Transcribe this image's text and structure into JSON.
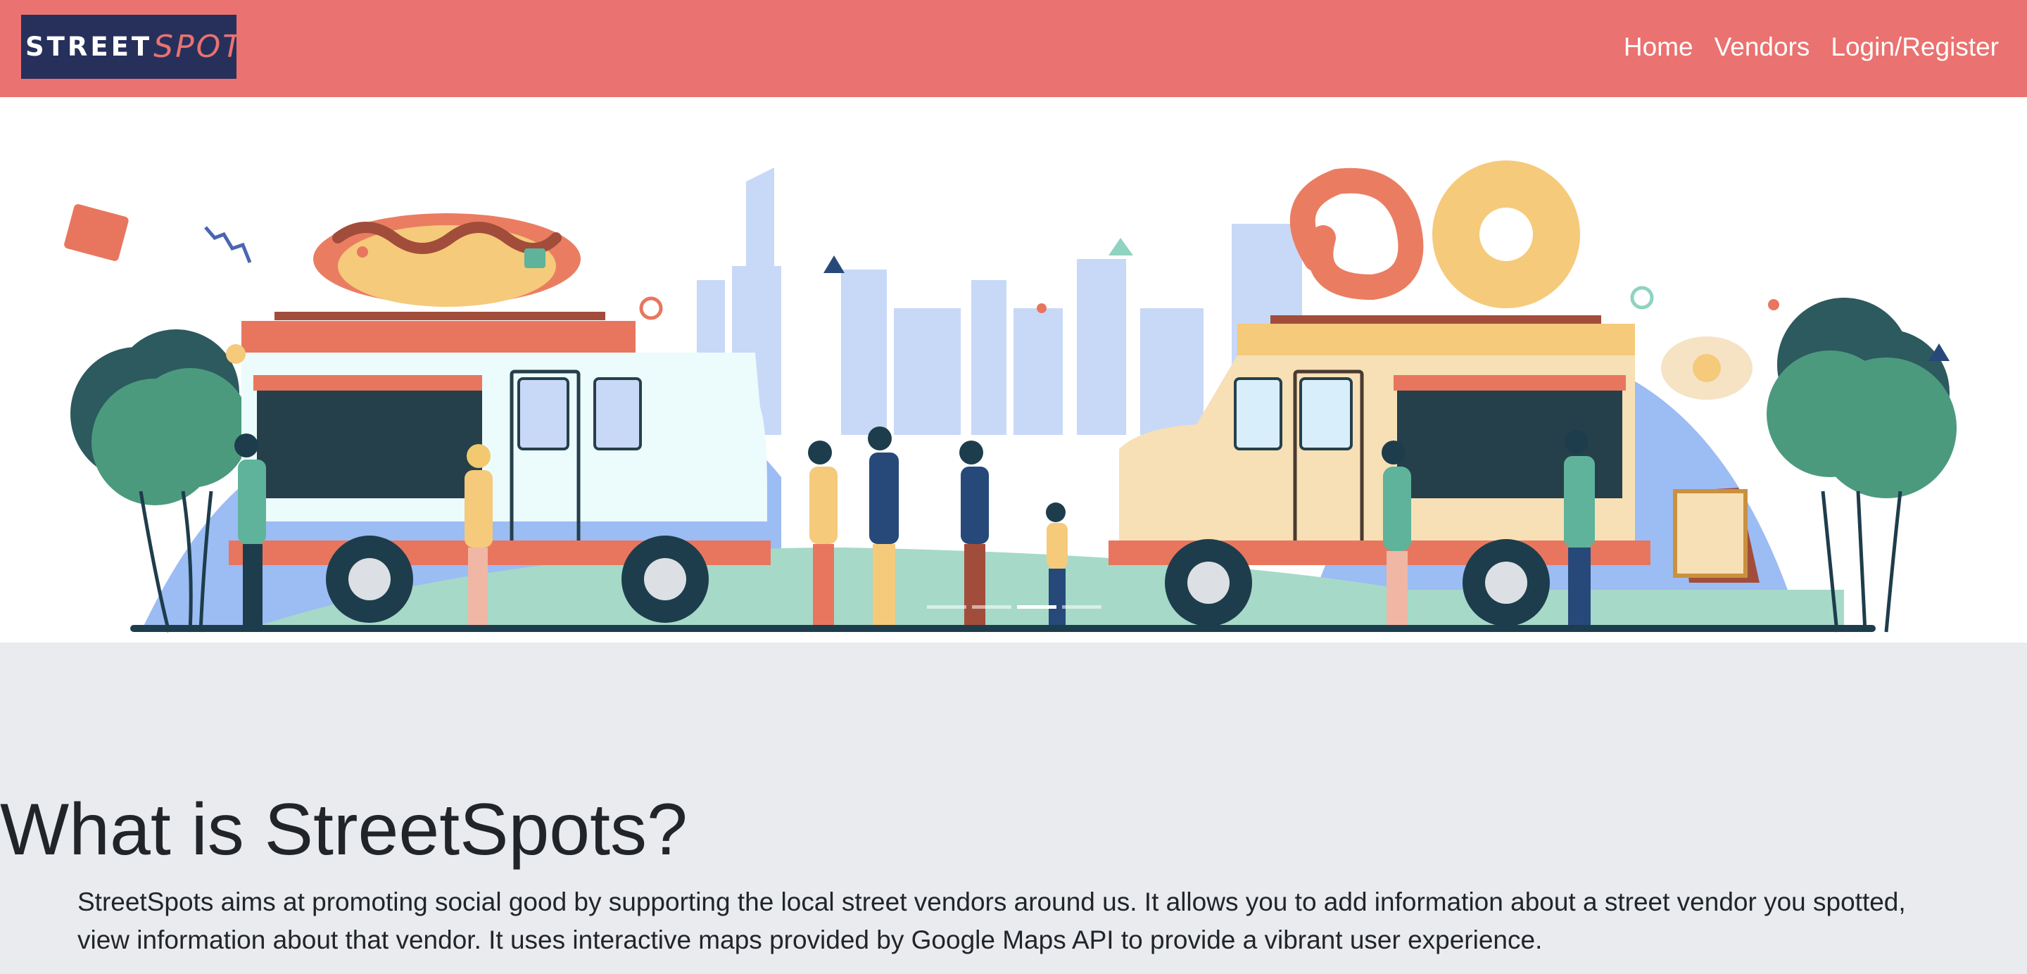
{
  "brand": {
    "street": "STREET",
    "spots": "SPOTS"
  },
  "nav": {
    "home": "Home",
    "vendors": "Vendors",
    "login": "Login/Register"
  },
  "carousel": {
    "slide_count": 4,
    "active_index": 2,
    "prev_icon": "chevron-left-icon",
    "next_icon": "chevron-right-icon"
  },
  "about": {
    "title": "What is StreetSpots?",
    "text": "StreetSpots aims at promoting social good by supporting the local street vendors around us. It allows you to add information about a street vendor you spotted, view information about that vendor. It uses interactive maps provided by Google Maps API to provide a vibrant user experience."
  },
  "colors": {
    "navbar": "#ea7270",
    "logo_bg": "#27305b",
    "page_bg": "#e9ebee",
    "text": "#212529"
  }
}
